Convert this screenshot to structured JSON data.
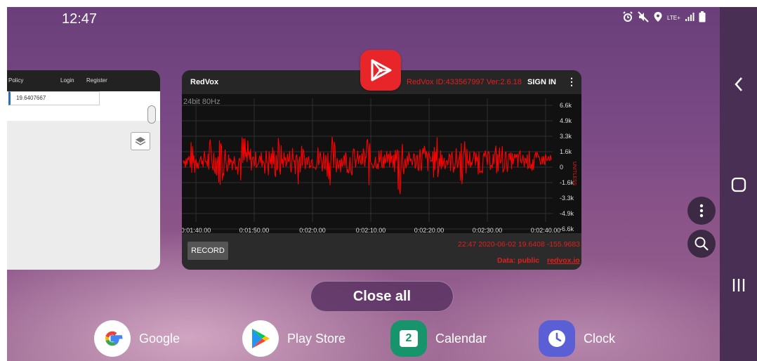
{
  "status_bar": {
    "time": "12:47",
    "network": "LTE+"
  },
  "recents": {
    "left_card": {
      "nav_items": [
        "Policy",
        "Login",
        "Register"
      ],
      "input_value": "19.6407667"
    },
    "redvox_card": {
      "title": "RedVox",
      "id_version": "RedVox ID:433567997 Ver:2.6.18",
      "sign_in": "SIGN IN",
      "menu": "⋮",
      "plot_caption": "24bit 80Hz",
      "record_button": "RECORD",
      "info_line": "22:47 2020-06-02  19.6408 -155.9683",
      "data_public": "Data: public",
      "link": "redvox.io",
      "colors": {
        "trace": "#ff0000",
        "accent": "#e02020",
        "background": "#111111"
      }
    },
    "close_all": "Close all"
  },
  "chart_data": {
    "type": "line",
    "title": "24bit 80Hz",
    "x_ticks": [
      "0:01:40.00",
      "0:01:50.00",
      "0:02:0.00",
      "0:02:10.00",
      "0:02:20.00",
      "0:02:30.00",
      "0:02:40.00"
    ],
    "y_ticks": [
      "6.6k",
      "4.9k",
      "3.3k",
      "1.6k",
      "0",
      "-1.6k",
      "-3.3k",
      "-4.9k",
      "-6.6k"
    ],
    "ylabel": "UNITLESS",
    "ylim": [
      -6600,
      6600
    ],
    "grid": true,
    "series": [
      {
        "color": "#ff0000",
        "envelope": [
          600,
          1500,
          2600,
          1200,
          900,
          2100,
          3000,
          1800,
          5100,
          2300,
          1300,
          1100,
          2700,
          4400,
          2000,
          1400,
          1000,
          1600,
          2500,
          1800,
          3700,
          1500,
          1300,
          2200,
          4200,
          1800,
          1400,
          1200,
          1600,
          2400,
          1500,
          3100,
          2800,
          1400,
          1200,
          2600,
          2000,
          1100,
          1500,
          3900,
          2200,
          1300,
          1700,
          1400,
          1000,
          2000,
          7000,
          1700,
          1500,
          1200,
          1800,
          2900,
          1400,
          2100,
          3300,
          1900,
          1200,
          1500,
          2600,
          3400,
          1800,
          1200,
          1400,
          2400,
          1500,
          1100,
          1700,
          2300,
          1900,
          1300,
          900,
          1500,
          1100,
          1300,
          2000,
          1100,
          800,
          1300,
          600
        ]
      }
    ]
  },
  "dock": [
    {
      "label": "Google"
    },
    {
      "label": "Play Store"
    },
    {
      "label": "Calendar",
      "badge": "2"
    },
    {
      "label": "Clock"
    }
  ]
}
